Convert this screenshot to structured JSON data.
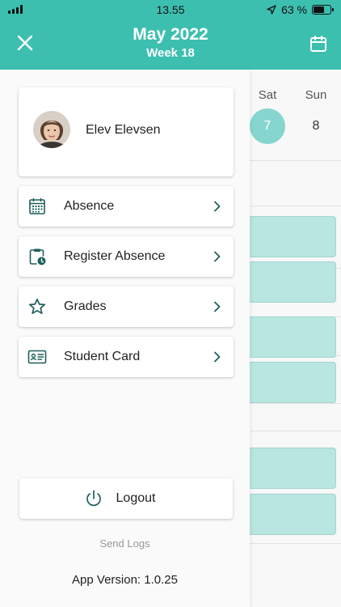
{
  "status_bar": {
    "time": "13.55",
    "battery_text": "63 %",
    "battery_level": 0.63
  },
  "header": {
    "title": "May 2022",
    "subtitle": "Week 18",
    "background": "#3dbfb0"
  },
  "calendar": {
    "days": [
      {
        "name": "Sat",
        "number": "7",
        "selected": true
      },
      {
        "name": "Sun",
        "number": "8",
        "selected": false
      }
    ]
  },
  "profile": {
    "name": "Elev Elevsen"
  },
  "menu": {
    "items": [
      {
        "label": "Absence",
        "icon": "calendar-grid-icon"
      },
      {
        "label": "Register Absence",
        "icon": "clipboard-clock-icon"
      },
      {
        "label": "Grades",
        "icon": "star-icon"
      },
      {
        "label": "Student Card",
        "icon": "id-card-icon"
      }
    ]
  },
  "footer": {
    "logout_label": "Logout",
    "send_logs_label": "Send Logs",
    "version_text": "App Version:  1.0.25"
  },
  "colors": {
    "accent": "#3dbfb0",
    "icon": "#1f5f5c",
    "selected_day": "#86d6cf",
    "event": "#b9e6e1"
  }
}
